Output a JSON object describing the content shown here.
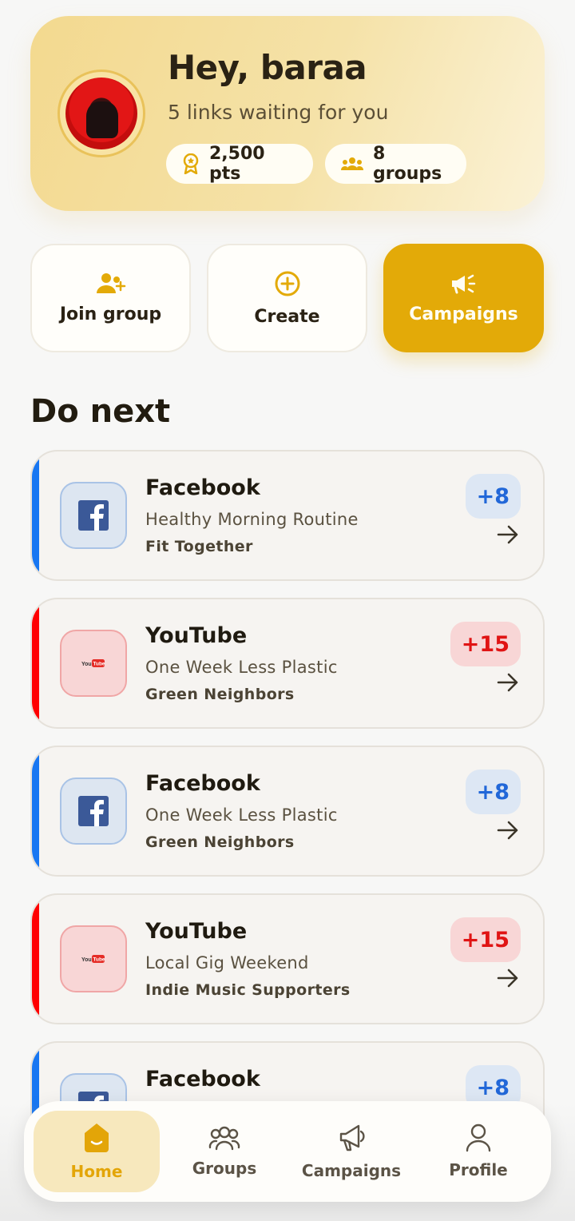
{
  "hero": {
    "greeting": "Hey, baraa",
    "subtitle": "5 links waiting for you",
    "points": "2,500 pts",
    "groups": "8 groups",
    "avatar_icon": "user-photo"
  },
  "quick_actions": [
    {
      "label": "Join group",
      "icon": "user-plus-icon"
    },
    {
      "label": "Create",
      "icon": "plus-circle-icon"
    },
    {
      "label": "Campaigns",
      "icon": "megaphone-icon"
    }
  ],
  "section_title": "Do next",
  "tasks": [
    {
      "platform": "Facebook",
      "campaign": "Healthy Morning Routine",
      "group": "Fit Together",
      "points": "+8",
      "color": "#1877f2"
    },
    {
      "platform": "YouTube",
      "campaign": "One Week Less Plastic",
      "group": "Green Neighbors",
      "points": "+15",
      "color": "#ff0000"
    },
    {
      "platform": "Facebook",
      "campaign": "One Week Less Plastic",
      "group": "Green Neighbors",
      "points": "+8",
      "color": "#1877f2"
    },
    {
      "platform": "YouTube",
      "campaign": "Local Gig Weekend",
      "group": "Indie Music Supporters",
      "points": "+15",
      "color": "#ff0000"
    },
    {
      "platform": "Facebook",
      "campaign": "",
      "group": "",
      "points": "+8",
      "color": "#1877f2"
    }
  ],
  "nav": {
    "home": "Home",
    "groups": "Groups",
    "campaigns": "Campaigns",
    "profile": "Profile",
    "active": "home"
  },
  "colors": {
    "accent": "#e3aa08",
    "facebook": "#1877f2",
    "youtube": "#ff0000"
  }
}
